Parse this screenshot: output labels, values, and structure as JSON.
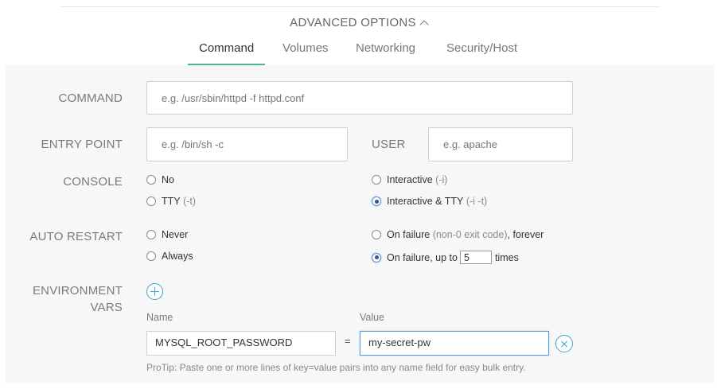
{
  "header": {
    "advanced_options": "ADVANCED OPTIONS"
  },
  "tabs": [
    {
      "label": "Command",
      "active": true
    },
    {
      "label": "Volumes",
      "active": false
    },
    {
      "label": "Networking",
      "active": false
    },
    {
      "label": "Security/Host",
      "active": false
    }
  ],
  "command": {
    "label": "COMMAND",
    "placeholder": "e.g. /usr/sbin/httpd -f httpd.conf"
  },
  "entry_point": {
    "label": "ENTRY POINT",
    "placeholder": "e.g. /bin/sh -c"
  },
  "user": {
    "label": "USER",
    "placeholder": "e.g. apache"
  },
  "console": {
    "label": "CONSOLE",
    "options": [
      {
        "label": "No",
        "hint": "",
        "selected": false
      },
      {
        "label": "TTY",
        "hint": "(-t)",
        "selected": false
      },
      {
        "label": "Interactive",
        "hint": "(-i)",
        "selected": false
      },
      {
        "label": "Interactive & TTY",
        "hint": "(-i -t)",
        "selected": true
      }
    ]
  },
  "auto_restart": {
    "label": "AUTO RESTART",
    "never": "Never",
    "always": "Always",
    "on_failure_forever": {
      "label": "On failure",
      "hint": "(non-0 exit code)",
      "suffix": ", forever"
    },
    "on_failure_limit": {
      "label": "On failure, up to",
      "value": "5",
      "suffix": "times",
      "selected": true
    }
  },
  "env": {
    "label_line1": "ENVIRONMENT",
    "label_line2": "VARS",
    "name_header": "Name",
    "value_header": "Value",
    "equals": "=",
    "rows": [
      {
        "name": "MYSQL_ROOT_PASSWORD",
        "value": "my-secret-pw"
      }
    ],
    "protip": "ProTip: Paste one or more lines of key=value pairs into any name field for easy bulk entry."
  },
  "colors": {
    "accent": "#4eb396",
    "link": "#3aa6c8",
    "panel": "#f7f7f7"
  }
}
